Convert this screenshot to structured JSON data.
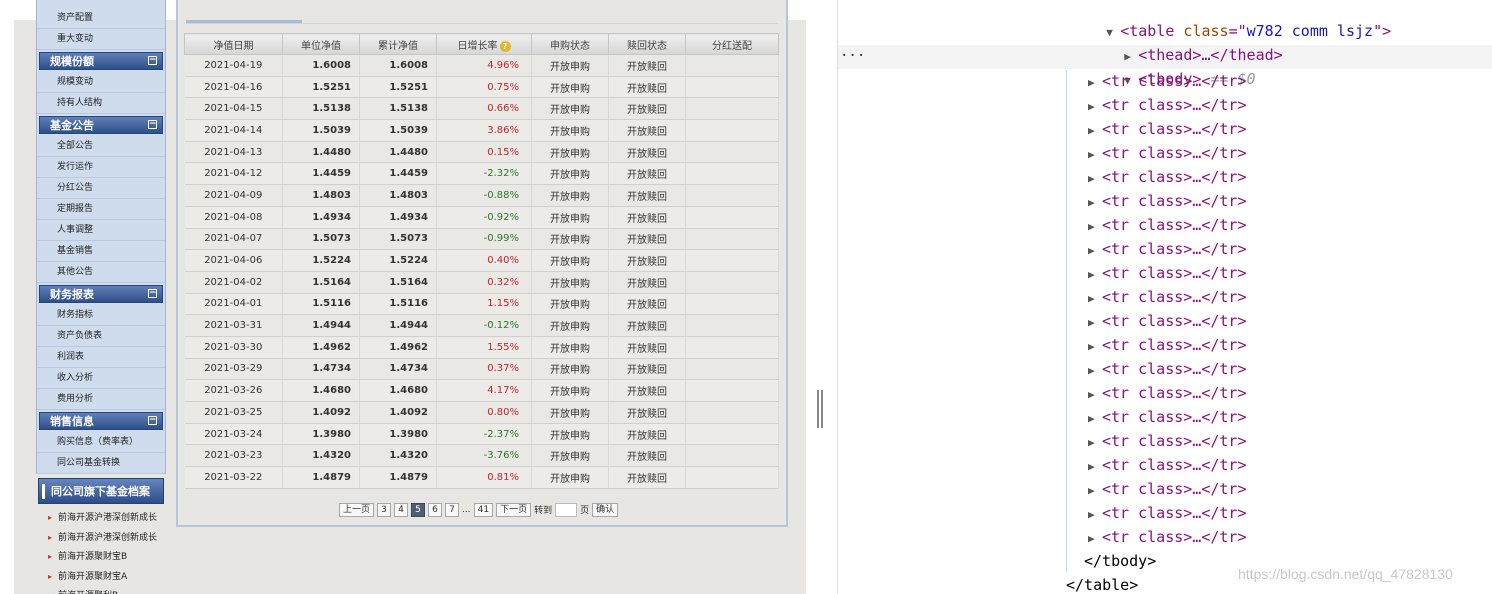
{
  "sidebar": {
    "top_items": [
      {
        "label": "资产配置"
      },
      {
        "label": "重大变动"
      }
    ],
    "sections": [
      {
        "title": "规模份额",
        "toggle": "−",
        "items": [
          {
            "label": "规模变动"
          },
          {
            "label": "持有人结构"
          }
        ]
      },
      {
        "title": "基金公告",
        "toggle": "−",
        "items": [
          {
            "label": "全部公告"
          },
          {
            "label": "发行运作"
          },
          {
            "label": "分红公告"
          },
          {
            "label": "定期报告"
          },
          {
            "label": "人事调整"
          },
          {
            "label": "基金销售"
          },
          {
            "label": "其他公告"
          }
        ]
      },
      {
        "title": "财务报表",
        "toggle": "−",
        "items": [
          {
            "label": "财务指标"
          },
          {
            "label": "资产负债表"
          },
          {
            "label": "利润表"
          },
          {
            "label": "收入分析"
          },
          {
            "label": "费用分析"
          }
        ]
      },
      {
        "title": "销售信息",
        "toggle": "−",
        "items": [
          {
            "label": "购买信息（费率表）"
          },
          {
            "label": "同公司基金转换"
          }
        ]
      }
    ]
  },
  "fund_files": {
    "title": "同公司旗下基金档案",
    "items": [
      {
        "label": "前海开源沪港深创新成长"
      },
      {
        "label": "前海开源沪港深创新成长"
      },
      {
        "label": "前海开源聚财宝B"
      },
      {
        "label": "前海开源聚财宝A"
      },
      {
        "label": "前海开源聚利B"
      }
    ]
  },
  "table": {
    "headers": [
      "净值日期",
      "单位净值",
      "累计净值",
      "日增长率",
      "申购状态",
      "赎回状态",
      "分红送配"
    ],
    "help_icon": "?",
    "rows": [
      {
        "date": "2021-04-19",
        "nav": "1.6008",
        "acc": "1.6008",
        "growth": "4.96%",
        "trend": "up",
        "buy": "开放申购",
        "redeem": "开放赎回",
        "dividend": ""
      },
      {
        "date": "2021-04-16",
        "nav": "1.5251",
        "acc": "1.5251",
        "growth": "0.75%",
        "trend": "up",
        "buy": "开放申购",
        "redeem": "开放赎回",
        "dividend": ""
      },
      {
        "date": "2021-04-15",
        "nav": "1.5138",
        "acc": "1.5138",
        "growth": "0.66%",
        "trend": "up",
        "buy": "开放申购",
        "redeem": "开放赎回",
        "dividend": ""
      },
      {
        "date": "2021-04-14",
        "nav": "1.5039",
        "acc": "1.5039",
        "growth": "3.86%",
        "trend": "up",
        "buy": "开放申购",
        "redeem": "开放赎回",
        "dividend": ""
      },
      {
        "date": "2021-04-13",
        "nav": "1.4480",
        "acc": "1.4480",
        "growth": "0.15%",
        "trend": "up",
        "buy": "开放申购",
        "redeem": "开放赎回",
        "dividend": ""
      },
      {
        "date": "2021-04-12",
        "nav": "1.4459",
        "acc": "1.4459",
        "growth": "-2.32%",
        "trend": "down",
        "buy": "开放申购",
        "redeem": "开放赎回",
        "dividend": ""
      },
      {
        "date": "2021-04-09",
        "nav": "1.4803",
        "acc": "1.4803",
        "growth": "-0.88%",
        "trend": "down",
        "buy": "开放申购",
        "redeem": "开放赎回",
        "dividend": ""
      },
      {
        "date": "2021-04-08",
        "nav": "1.4934",
        "acc": "1.4934",
        "growth": "-0.92%",
        "trend": "down",
        "buy": "开放申购",
        "redeem": "开放赎回",
        "dividend": ""
      },
      {
        "date": "2021-04-07",
        "nav": "1.5073",
        "acc": "1.5073",
        "growth": "-0.99%",
        "trend": "down",
        "buy": "开放申购",
        "redeem": "开放赎回",
        "dividend": ""
      },
      {
        "date": "2021-04-06",
        "nav": "1.5224",
        "acc": "1.5224",
        "growth": "0.40%",
        "trend": "up",
        "buy": "开放申购",
        "redeem": "开放赎回",
        "dividend": ""
      },
      {
        "date": "2021-04-02",
        "nav": "1.5164",
        "acc": "1.5164",
        "growth": "0.32%",
        "trend": "up",
        "buy": "开放申购",
        "redeem": "开放赎回",
        "dividend": ""
      },
      {
        "date": "2021-04-01",
        "nav": "1.5116",
        "acc": "1.5116",
        "growth": "1.15%",
        "trend": "up",
        "buy": "开放申购",
        "redeem": "开放赎回",
        "dividend": ""
      },
      {
        "date": "2021-03-31",
        "nav": "1.4944",
        "acc": "1.4944",
        "growth": "-0.12%",
        "trend": "down",
        "buy": "开放申购",
        "redeem": "开放赎回",
        "dividend": ""
      },
      {
        "date": "2021-03-30",
        "nav": "1.4962",
        "acc": "1.4962",
        "growth": "1.55%",
        "trend": "up",
        "buy": "开放申购",
        "redeem": "开放赎回",
        "dividend": ""
      },
      {
        "date": "2021-03-29",
        "nav": "1.4734",
        "acc": "1.4734",
        "growth": "0.37%",
        "trend": "up",
        "buy": "开放申购",
        "redeem": "开放赎回",
        "dividend": ""
      },
      {
        "date": "2021-03-26",
        "nav": "1.4680",
        "acc": "1.4680",
        "growth": "4.17%",
        "trend": "up",
        "buy": "开放申购",
        "redeem": "开放赎回",
        "dividend": ""
      },
      {
        "date": "2021-03-25",
        "nav": "1.4092",
        "acc": "1.4092",
        "growth": "0.80%",
        "trend": "up",
        "buy": "开放申购",
        "redeem": "开放赎回",
        "dividend": ""
      },
      {
        "date": "2021-03-24",
        "nav": "1.3980",
        "acc": "1.3980",
        "growth": "-2.37%",
        "trend": "down",
        "buy": "开放申购",
        "redeem": "开放赎回",
        "dividend": ""
      },
      {
        "date": "2021-03-23",
        "nav": "1.4320",
        "acc": "1.4320",
        "growth": "-3.76%",
        "trend": "down",
        "buy": "开放申购",
        "redeem": "开放赎回",
        "dividend": ""
      },
      {
        "date": "2021-03-22",
        "nav": "1.4879",
        "acc": "1.4879",
        "growth": "0.81%",
        "trend": "up",
        "buy": "开放申购",
        "redeem": "开放赎回",
        "dividend": ""
      }
    ]
  },
  "pager": {
    "prev_label": "上一页",
    "pages": [
      "3",
      "4",
      "5",
      "6",
      "7"
    ],
    "current": "5",
    "ellipsis": "...",
    "last": "41",
    "next_label": "下一页",
    "goto_label": "转到",
    "page_unit": "页",
    "confirm_label": "确认"
  },
  "devtools": {
    "dots": "···",
    "table_open": {
      "tag": "table",
      "attr": "class",
      "value": "w782 comm lsjz"
    },
    "thead": "<thead>…</thead>",
    "tbody_open": "<tbody>",
    "tbody_marker": "== $0",
    "row_line": "<tr class>…</tr>",
    "row_count": 20,
    "tbody_close": "</tbody>",
    "table_close": "</table>"
  },
  "watermark": "https://blog.csdn.net/qq_47828130",
  "colors": {
    "up": "#c0262d",
    "down": "#2a7a2a",
    "tag": "#881280",
    "attr": "#994500",
    "value": "#1a1aa6"
  }
}
